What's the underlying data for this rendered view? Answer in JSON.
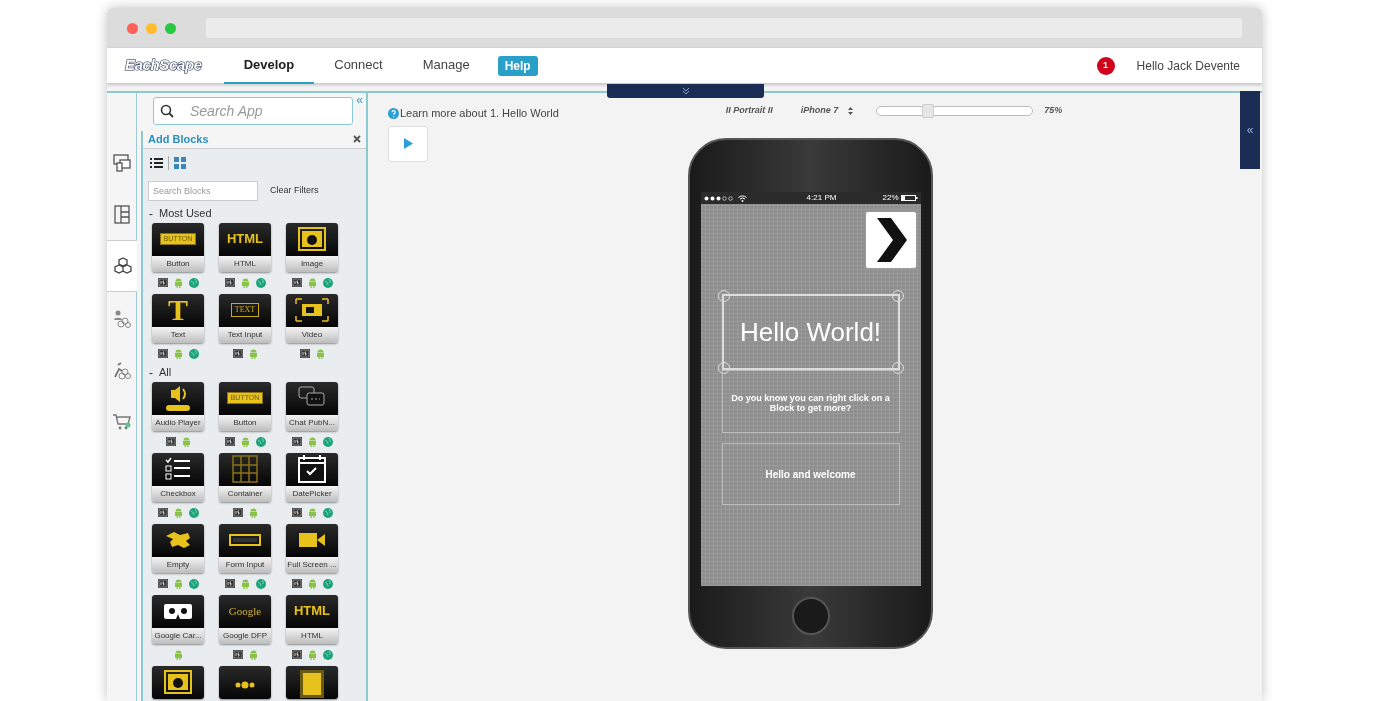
{
  "header": {
    "logo": "EachScape",
    "nav": [
      {
        "label": "Develop",
        "selected": true
      },
      {
        "label": "Connect",
        "selected": false
      },
      {
        "label": "Manage",
        "selected": false
      }
    ],
    "help_button": "Help",
    "notification_count": "1",
    "greeting": "Hello Jack Devente"
  },
  "sidebar": {
    "search": {
      "placeholder": "Search App"
    },
    "collapse": "«",
    "tool_tabs": [
      {
        "kind": "screens",
        "selected": false
      },
      {
        "kind": "layout",
        "selected": false
      },
      {
        "kind": "blocks",
        "selected": true
      },
      {
        "kind": "users",
        "selected": false
      },
      {
        "kind": "actions",
        "selected": false
      },
      {
        "kind": "store",
        "selected": false
      }
    ],
    "panel": {
      "title": "Add Blocks",
      "view_modes": [
        {
          "kind": "list",
          "selected": true
        },
        {
          "kind": "grid",
          "selected": false
        }
      ],
      "search_blocks": {
        "placeholder": "Search Blocks"
      },
      "clear_filters": "Clear Filters",
      "sections": [
        {
          "toggle": "-",
          "title": "Most Used",
          "blocks": [
            {
              "kind": "button",
              "icon_text": "BUTTON",
              "label": "Button",
              "ios": true,
              "android": true,
              "web": true
            },
            {
              "kind": "html",
              "icon_text": "HTML",
              "label": "HTML",
              "ios": true,
              "android": true,
              "web": true
            },
            {
              "kind": "image",
              "label": "Image",
              "ios": true,
              "android": true,
              "web": true
            },
            {
              "kind": "text",
              "icon_text": "T",
              "label": "Text",
              "ios": true,
              "android": true,
              "web": true
            },
            {
              "kind": "text_input",
              "icon_text": "TEXT",
              "label": "Text Input",
              "ios": true,
              "android": true,
              "web": false
            },
            {
              "kind": "video",
              "label": "Video",
              "ios": true,
              "android": true,
              "web": false
            }
          ]
        },
        {
          "toggle": "-",
          "title": "All",
          "blocks": [
            {
              "kind": "audio",
              "label": "Audio Player",
              "ios": true,
              "android": true,
              "web": false
            },
            {
              "kind": "button",
              "icon_text": "BUTTON",
              "label": "Button",
              "ios": true,
              "android": true,
              "web": true
            },
            {
              "kind": "chat",
              "label": "Chat PubN...",
              "ios": true,
              "android": true,
              "web": true
            },
            {
              "kind": "checkbox",
              "label": "Checkbox",
              "ios": true,
              "android": true,
              "web": true
            },
            {
              "kind": "container",
              "label": "Container",
              "ios": true,
              "android": true,
              "web": false
            },
            {
              "kind": "datepicker",
              "label": "DatePicker",
              "ios": true,
              "android": true,
              "web": true
            },
            {
              "kind": "empty",
              "label": "Empty",
              "ios": true,
              "android": true,
              "web": true
            },
            {
              "kind": "form_input",
              "label": "Form Input",
              "ios": true,
              "android": true,
              "web": true
            },
            {
              "kind": "fullscreen_video",
              "label": "Full Screen ...",
              "ios": true,
              "android": true,
              "web": true
            },
            {
              "kind": "cardboard",
              "label": "Google Car...",
              "ios": false,
              "android": true,
              "web": false
            },
            {
              "kind": "google_dfp",
              "icon_text": "Google",
              "label": "Google DFP",
              "ios": true,
              "android": true,
              "web": false
            },
            {
              "kind": "html",
              "icon_text": "HTML",
              "label": "HTML",
              "ios": true,
              "android": true,
              "web": true
            },
            {
              "kind": "image"
            },
            {
              "kind": "dots"
            },
            {
              "kind": "gallery"
            }
          ]
        }
      ]
    }
  },
  "canvas": {
    "help_text": "Learn more about 1. Hello World",
    "orientation": "II Portrait II",
    "device": "iPhone 7",
    "zoom": {
      "level": 0.33
    },
    "zoom_reading": "75%",
    "right_tab": "«",
    "phone": {
      "time": "4:21 PM",
      "battery": "22%",
      "blocks": [
        {
          "kind": "heading",
          "text": "Hello World!",
          "selected": true
        },
        {
          "kind": "paragraph",
          "text": "Do you know you can right click on a Block to get more?",
          "selected": false
        },
        {
          "kind": "button",
          "text": "Hello and welcome",
          "selected": false
        }
      ]
    }
  }
}
